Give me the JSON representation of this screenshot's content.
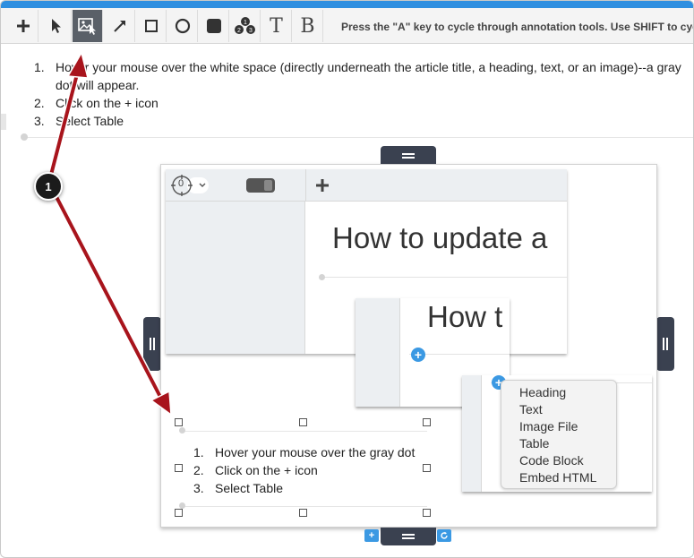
{
  "toolbar": {
    "hint": "Press the \"A\" key to cycle through annotation tools. Use SHIFT to cycle back",
    "tools": [
      {
        "icon": "plus-icon"
      },
      {
        "icon": "pointer-icon"
      },
      {
        "icon": "image-select-icon",
        "active": true
      },
      {
        "icon": "arrow-icon"
      },
      {
        "icon": "square-icon"
      },
      {
        "icon": "circle-icon"
      },
      {
        "icon": "filled-square-icon"
      },
      {
        "icon": "numbered-steps-icon"
      },
      {
        "label": "T"
      },
      {
        "label": "B"
      }
    ]
  },
  "instructions": {
    "items": [
      {
        "num": "1.",
        "text": "Hover your mouse over the white space (directly underneath the article title, a heading, text, or an image)--a gray dot will appear."
      },
      {
        "num": "2.",
        "text": "Click on the + icon"
      },
      {
        "num": "3.",
        "text": "Select Table"
      }
    ]
  },
  "canvas": {
    "screenshot_title": "How to update a",
    "popup_title": "How t",
    "gear_counter": "0",
    "menu_items": [
      "Heading",
      "Text",
      "Image File",
      "Table",
      "Code Block",
      "Embed HTML"
    ],
    "block_items": [
      {
        "num": "1.",
        "text": "Hover your mouse over the gray dot"
      },
      {
        "num": "2.",
        "text": "Click on the + icon"
      },
      {
        "num": "3.",
        "text": "Select Table"
      }
    ]
  },
  "annotation": {
    "badge": "1",
    "arrow_color": "#a8141c"
  },
  "colors": {
    "accent": "#2f8fe0",
    "handle": "#3a4150",
    "plus": "#3b99e3"
  }
}
